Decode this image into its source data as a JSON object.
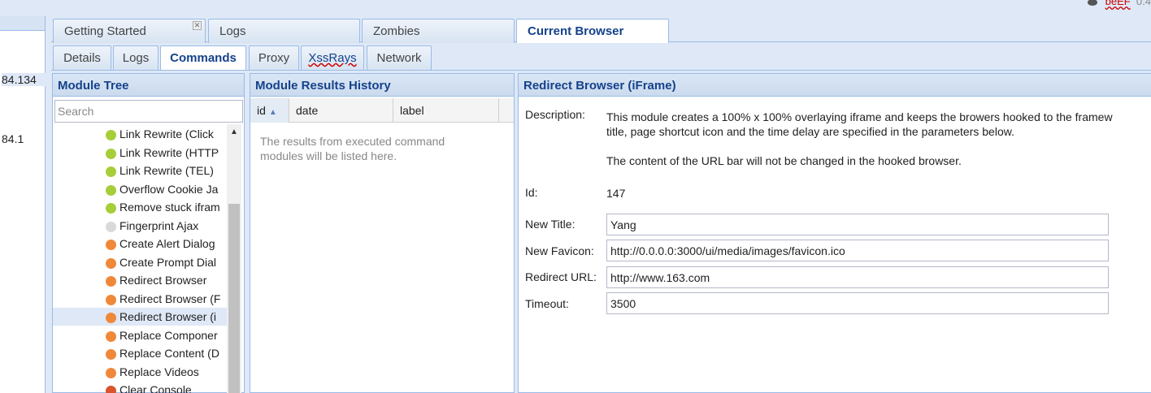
{
  "top": {
    "app_name_partial": "beEF",
    "version_partial": "0.4"
  },
  "browsers": {
    "ips": [
      "84.134",
      "84.1"
    ]
  },
  "main_tabs": [
    {
      "label": "Getting Started"
    },
    {
      "label": "Logs"
    },
    {
      "label": "Zombies"
    },
    {
      "label": "Current Browser"
    }
  ],
  "sub_tabs": [
    {
      "label": "Details"
    },
    {
      "label": "Logs"
    },
    {
      "label": "Commands"
    },
    {
      "label": "Proxy"
    },
    {
      "label": "XssRays"
    },
    {
      "label": "Network"
    }
  ],
  "module_tree": {
    "title": "Module Tree",
    "search_placeholder": "Search",
    "items": [
      {
        "label": "Link Rewrite (Click",
        "status": "green"
      },
      {
        "label": "Link Rewrite (HTTP",
        "status": "green"
      },
      {
        "label": "Link Rewrite (TEL)",
        "status": "green"
      },
      {
        "label": "Overflow Cookie Ja",
        "status": "green"
      },
      {
        "label": "Remove stuck ifram",
        "status": "green"
      },
      {
        "label": "Fingerprint Ajax",
        "status": "grey"
      },
      {
        "label": "Create Alert Dialog",
        "status": "orange"
      },
      {
        "label": "Create Prompt Dial",
        "status": "orange"
      },
      {
        "label": "Redirect Browser",
        "status": "orange"
      },
      {
        "label": "Redirect Browser (F",
        "status": "orange"
      },
      {
        "label": "Redirect Browser (i",
        "status": "orange",
        "selected": true
      },
      {
        "label": "Replace Componer",
        "status": "orange"
      },
      {
        "label": "Replace Content (D",
        "status": "orange"
      },
      {
        "label": "Replace Videos",
        "status": "orange"
      },
      {
        "label": "Clear Console",
        "status": "red"
      }
    ]
  },
  "results": {
    "title": "Module Results History",
    "columns": [
      "id",
      "date",
      "label"
    ],
    "empty_message": "The results from executed command modules will be listed here."
  },
  "detail": {
    "title": "Redirect Browser (iFrame)",
    "description_label": "Description:",
    "description_line1": "This module creates a 100% x 100% overlaying iframe and keeps the browers hooked to the framew",
    "description_line2": "title, page shortcut icon and the time delay are specified in the parameters below.",
    "description_line3": "The content of the URL bar will not be changed in the hooked browser.",
    "id_label": "Id:",
    "id_value": "147",
    "fields": [
      {
        "label": "New Title:",
        "value": "Yang"
      },
      {
        "label": "New Favicon:",
        "value": "http://0.0.0.0:3000/ui/media/images/favicon.ico"
      },
      {
        "label": "Redirect URL:",
        "value": "http://www.163.com"
      },
      {
        "label": "Timeout:",
        "value": "3500"
      }
    ]
  },
  "colors": {
    "green": "#a6ce39",
    "orange": "#f0883a",
    "grey": "#d9d9d9",
    "red": "#d9532c",
    "header_text": "#15428b"
  }
}
